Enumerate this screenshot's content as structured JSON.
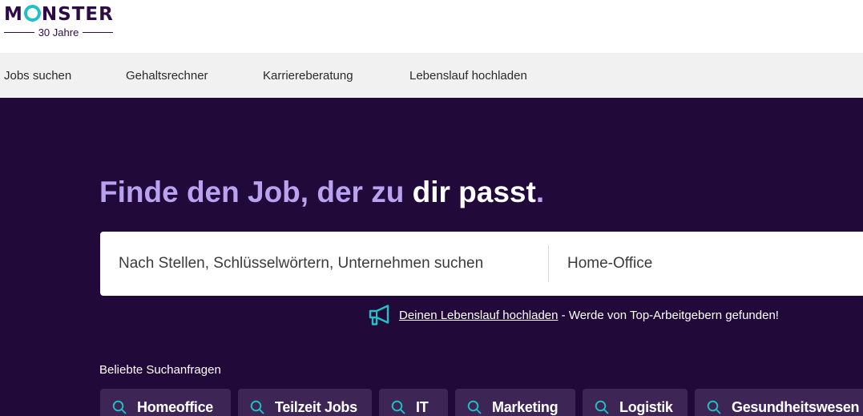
{
  "brand": {
    "name_pre": "M",
    "name_post": "NSTER",
    "tagline": "30 Jahre",
    "colors": {
      "brand_purple": "#2d0b44",
      "accent_teal": "#20c1c6",
      "hero_bg": "#21093a",
      "headline_lilac": "#b9a3f0"
    }
  },
  "nav": {
    "items": [
      {
        "label": "Jobs suchen"
      },
      {
        "label": "Gehaltsrechner"
      },
      {
        "label": "Karriereberatung"
      },
      {
        "label": "Lebenslauf hochladen"
      }
    ]
  },
  "hero": {
    "headline_part1": "Finde den Job, der zu",
    "headline_part2": "dir passt",
    "headline_dot": ".",
    "search_placeholder": "Nach Stellen, Schlüsselwörtern, Unternehmen suchen",
    "location_placeholder": "Home-Office",
    "cv_promo": {
      "icon": "megaphone-icon",
      "link_text": "Deinen Lebenslauf hochladen",
      "text": " - Werde von Top-Arbeitgebern gefunden!"
    },
    "popular_label": "Beliebte Suchanfragen",
    "popular_searches": [
      {
        "label": "Homeoffice",
        "icon": "search-icon"
      },
      {
        "label": "Teilzeit Jobs",
        "icon": "search-icon"
      },
      {
        "label": "IT",
        "icon": "search-icon"
      },
      {
        "label": "Marketing",
        "icon": "search-icon"
      },
      {
        "label": "Logistik",
        "icon": "search-icon"
      },
      {
        "label": "Gesundheitswesen",
        "icon": "search-icon"
      }
    ]
  }
}
